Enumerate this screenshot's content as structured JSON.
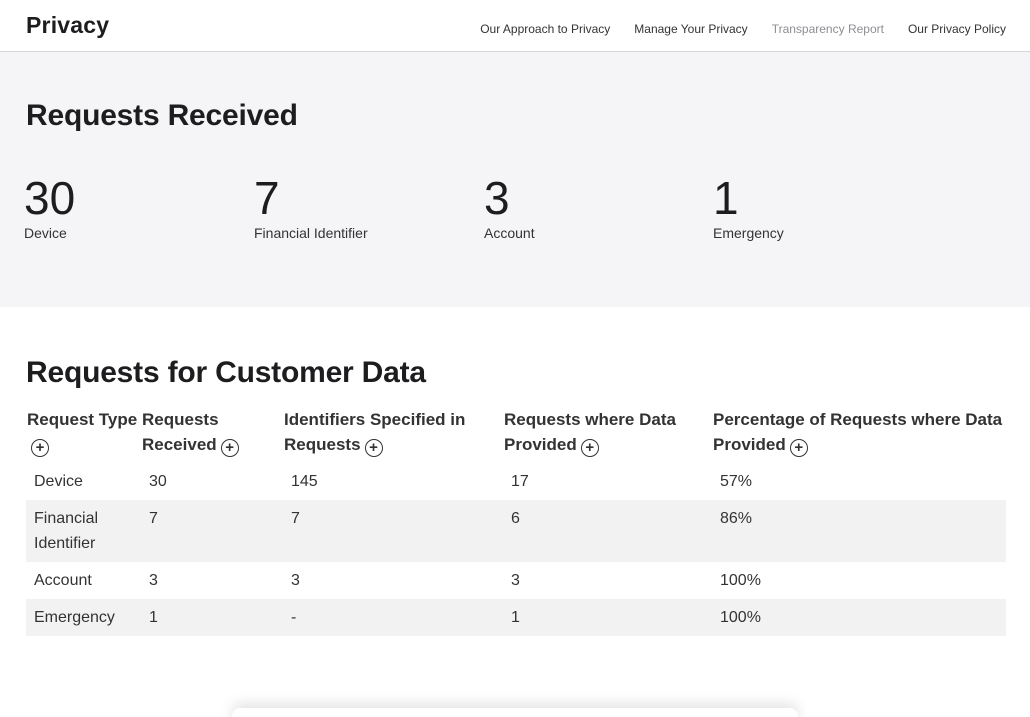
{
  "nav": {
    "brand": "Privacy",
    "links": [
      {
        "label": "Our Approach to Privacy"
      },
      {
        "label": "Manage Your Privacy"
      },
      {
        "label": "Transparency Report"
      },
      {
        "label": "Our Privacy Policy"
      }
    ]
  },
  "summary": {
    "title": "Requests Received",
    "stats": [
      {
        "value": "30",
        "label": "Device"
      },
      {
        "value": "7",
        "label": "Financial Identifier"
      },
      {
        "value": "3",
        "label": "Account"
      },
      {
        "value": "1",
        "label": "Emergency"
      }
    ]
  },
  "table": {
    "title": "Requests for Customer Data",
    "headers": [
      "Request Type",
      "Requests Received",
      "Identifiers Specified in Requests",
      "Requests where Data Provided",
      "Percentage of Requests where Data Provided"
    ],
    "rows": [
      [
        "Device",
        "30",
        "145",
        "17",
        "57%"
      ],
      [
        "Financial Identifier",
        "7",
        "7",
        "6",
        "86%"
      ],
      [
        "Account",
        "3",
        "3",
        "3",
        "100%"
      ],
      [
        "Emergency",
        "1",
        "-",
        "1",
        "100%"
      ]
    ]
  },
  "icons": {
    "expand": "plus-circle-icon"
  }
}
